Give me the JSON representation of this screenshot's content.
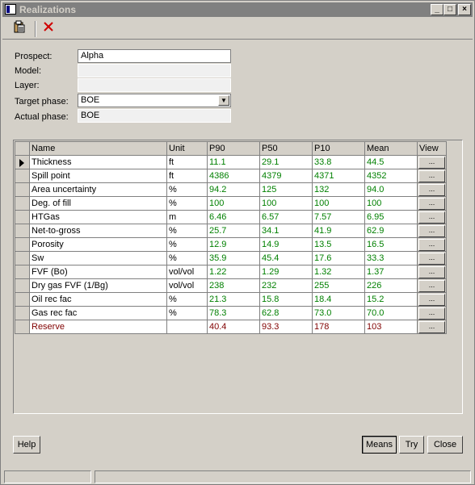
{
  "window": {
    "title": "Realizations",
    "controls": [
      "_",
      "□",
      "×"
    ]
  },
  "toolbar": {
    "items": [
      {
        "name": "paste-icon",
        "glyph": "📋"
      },
      {
        "name": "delete-icon",
        "glyph": "✕"
      }
    ]
  },
  "form": {
    "prospect_label": "Prospect:",
    "prospect_value": "Alpha",
    "model_label": "Model:",
    "model_value": "",
    "layer_label": "Layer:",
    "layer_value": "",
    "target_phase_label": "Target phase:",
    "target_phase_value": "BOE",
    "actual_phase_label": "Actual phase:",
    "actual_phase_value": "BOE"
  },
  "grid": {
    "columns": [
      "Name",
      "Unit",
      "P90",
      "P50",
      "P10",
      "Mean",
      "View"
    ],
    "view_button_label": "...",
    "rows": [
      {
        "name": "Thickness",
        "unit": "ft",
        "p90": "11.1",
        "p50": "29.1",
        "p10": "33.8",
        "mean": "44.5"
      },
      {
        "name": "Spill point",
        "unit": "ft",
        "p90": "4386",
        "p50": "4379",
        "p10": "4371",
        "mean": "4352"
      },
      {
        "name": "Area uncertainty",
        "unit": "%",
        "p90": "94.2",
        "p50": "125",
        "p10": "132",
        "mean": "94.0"
      },
      {
        "name": "Deg. of fill",
        "unit": "%",
        "p90": "100",
        "p50": "100",
        "p10": "100",
        "mean": "100"
      },
      {
        "name": "HTGas",
        "unit": "m",
        "p90": "6.46",
        "p50": "6.57",
        "p10": "7.57",
        "mean": "6.95"
      },
      {
        "name": "Net-to-gross",
        "unit": "%",
        "p90": "25.7",
        "p50": "34.1",
        "p10": "41.9",
        "mean": "62.9"
      },
      {
        "name": "Porosity",
        "unit": "%",
        "p90": "12.9",
        "p50": "14.9",
        "p10": "13.5",
        "mean": "16.5"
      },
      {
        "name": "Sw",
        "unit": "%",
        "p90": "35.9",
        "p50": "45.4",
        "p10": "17.6",
        "mean": "33.3"
      },
      {
        "name": "FVF (Bo)",
        "unit": "vol/vol",
        "p90": "1.22",
        "p50": "1.29",
        "p10": "1.32",
        "mean": "1.37"
      },
      {
        "name": "Dry gas FVF (1/Bg)",
        "unit": "vol/vol",
        "p90": "238",
        "p50": "232",
        "p10": "255",
        "mean": "226"
      },
      {
        "name": "Oil rec fac",
        "unit": "%",
        "p90": "21.3",
        "p50": "15.8",
        "p10": "18.4",
        "mean": "15.2"
      },
      {
        "name": "Gas rec fac",
        "unit": "%",
        "p90": "78.3",
        "p50": "62.8",
        "p10": "73.0",
        "mean": "70.0"
      },
      {
        "name": "Reserve",
        "unit": "",
        "p90": "40.4",
        "p50": "93.3",
        "p10": "178",
        "mean": "103"
      }
    ]
  },
  "buttons": {
    "help": "Help",
    "means": "Means",
    "try": "Try",
    "close": "Close"
  },
  "colors": {
    "value_green": "#008000",
    "reserve_red": "#800000",
    "titlebar_inactive": "#808080"
  }
}
